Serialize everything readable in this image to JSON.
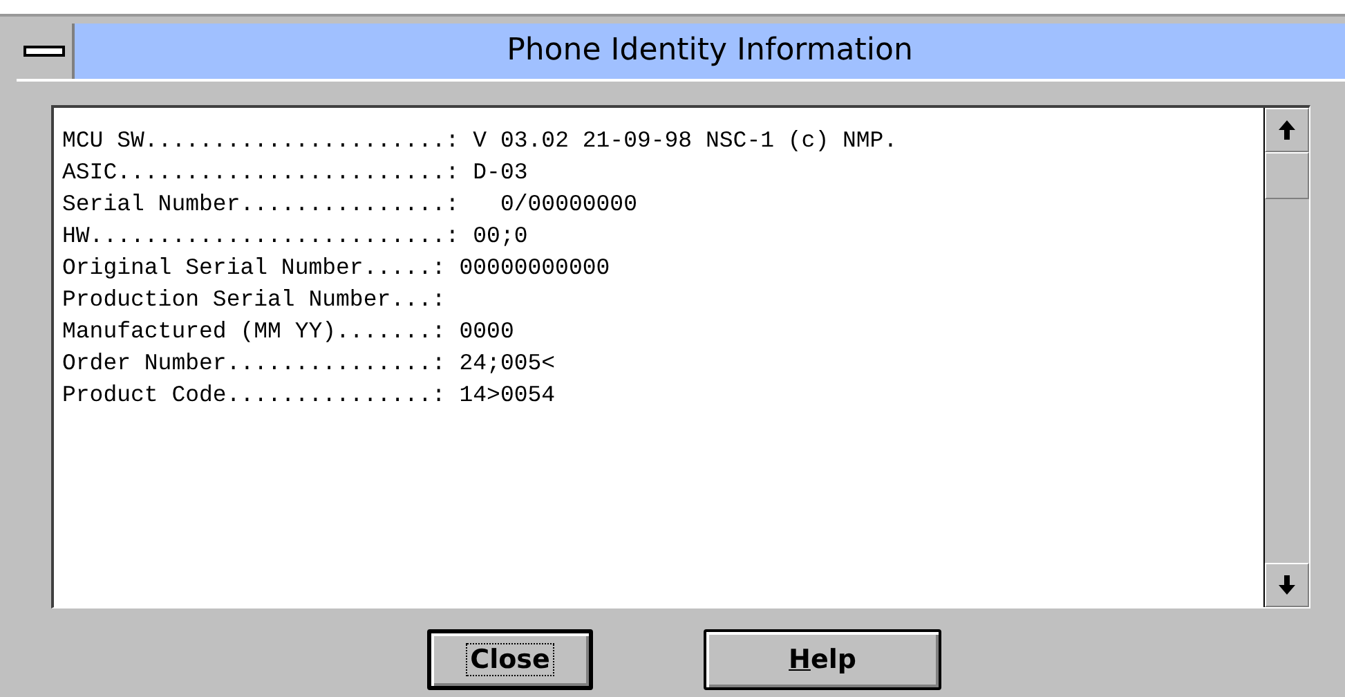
{
  "window": {
    "title": "Phone Identity Information"
  },
  "info_lines": [
    {
      "label": "MCU SW......................:",
      "value": "V 03.02 21-09-98 NSC-1 (c) NMP."
    },
    {
      "label": "ASIC........................:",
      "value": "D-03"
    },
    {
      "label": "Serial Number...............:",
      "value": "  0/00000000"
    },
    {
      "label": "HW..........................:",
      "value": "00;0"
    },
    {
      "label": "Original Serial Number.....:",
      "value": "00000000000"
    },
    {
      "label": "Production Serial Number...:"
    },
    {
      "label": "Manufactured (MM YY).......:",
      "value": "0000"
    },
    {
      "label": "Order Number...............:",
      "value": "24;005<"
    },
    {
      "label": "Product Code...............:",
      "value": "14>0054"
    }
  ],
  "buttons": [
    {
      "label": "Close",
      "focused": true,
      "mnemonic_first_letter": false
    },
    {
      "label": "Help",
      "focused": false,
      "mnemonic_first_letter": true
    }
  ]
}
